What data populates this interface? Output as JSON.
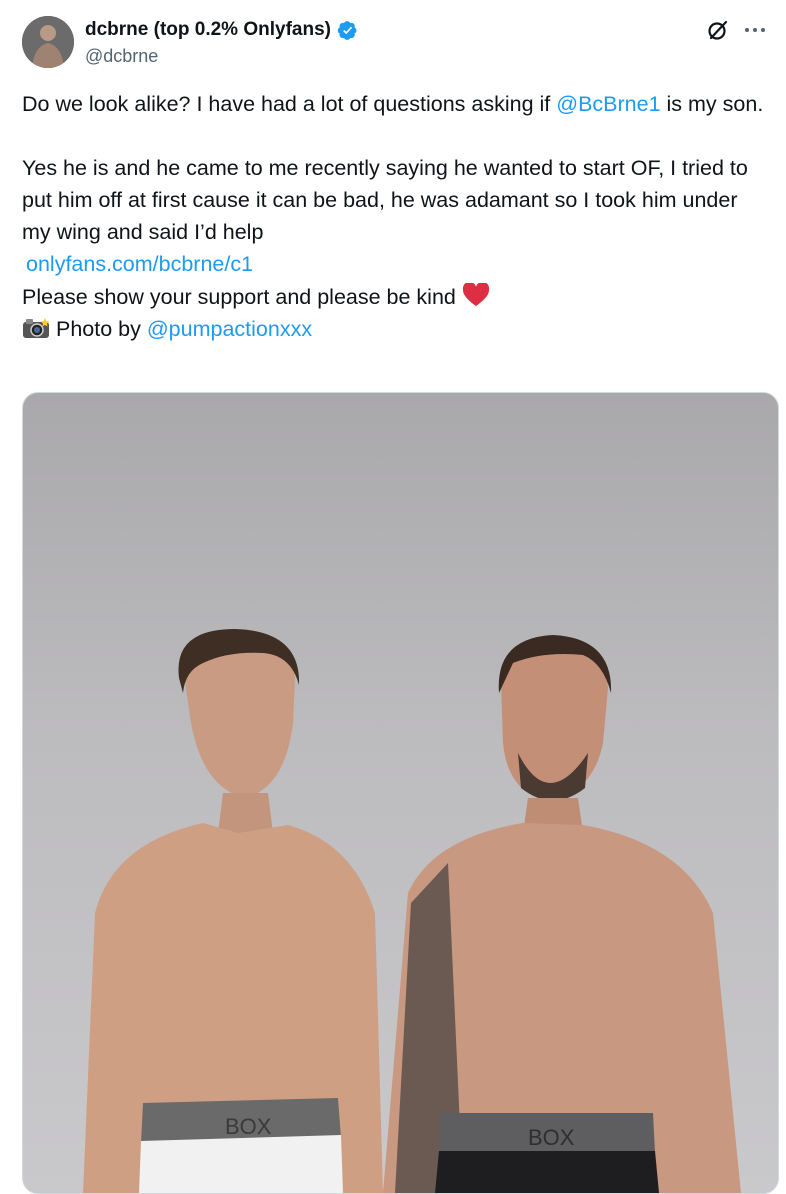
{
  "author": {
    "display_name": "dcbrne (top 0.2% Onlyfans)",
    "handle": "@dcbrne",
    "verified_icon": "verified-badge-icon",
    "badge_color": "#1d9bf0"
  },
  "tweet": {
    "line1_before": "Do we look alike? I have had a lot of questions asking if ",
    "line1_mention": "@BcBrne1",
    "line1_after": " is my son.",
    "para2": "Yes he is and he came to me recently saying he wanted to start OF, I tried to put him off at first cause it can be bad, he was adamant so I took him under my wing and said I’d help",
    "link": "onlyfans.com/bcbrne/c1",
    "line_support": "Please show your support and please be kind ",
    "heart": "❤",
    "photo_prefix": "Photo by ",
    "photo_mention": "@pumpactionxxx"
  },
  "media": {
    "waistband_left": "BOX",
    "waistband_right": "BOX"
  },
  "colors": {
    "link": "#1d9bf0",
    "text": "#0f1419",
    "muted": "#536471"
  }
}
